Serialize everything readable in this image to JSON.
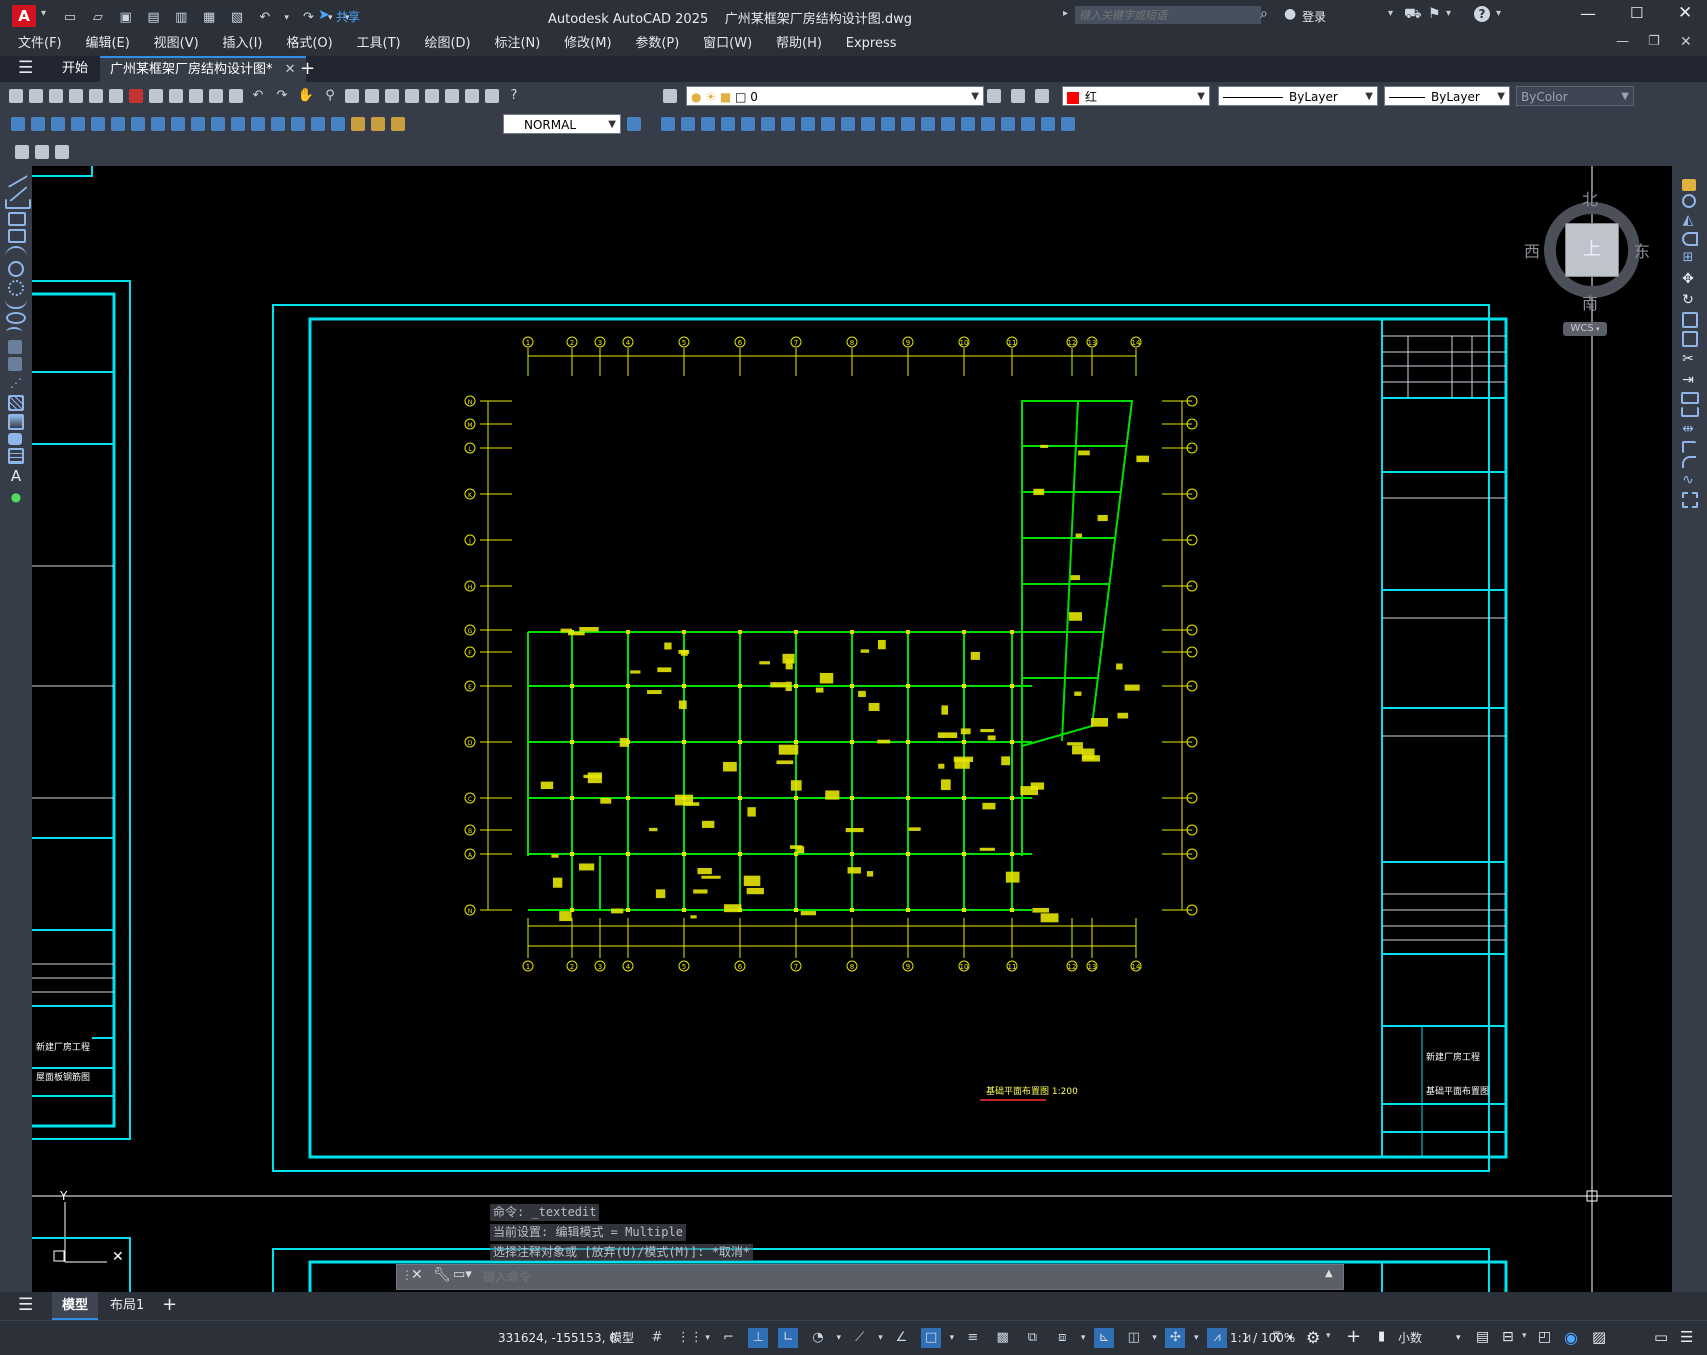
{
  "app": {
    "title": "Autodesk AutoCAD 2025    广州某框架厂房结构设计图.dwg",
    "logo_letter": "A",
    "share_label": "共享",
    "search_placeholder": "键入关键字或短语",
    "login_label": "登录"
  },
  "menu": [
    "文件(F)",
    "编辑(E)",
    "视图(V)",
    "插入(I)",
    "格式(O)",
    "工具(T)",
    "绘图(D)",
    "标注(N)",
    "修改(M)",
    "参数(P)",
    "窗口(W)",
    "帮助(H)",
    "Express"
  ],
  "tabs": {
    "start": "开始",
    "document": "广州某框架厂房结构设计图*",
    "add": "+"
  },
  "properties": {
    "layer": "0",
    "color": "红",
    "color_hex": "#ff0000",
    "linetype": "ByLayer",
    "lineweight": "ByLayer",
    "plotstyle": "ByColor",
    "dimstyle": "NORMAL"
  },
  "viewcube": {
    "north": "北",
    "south": "南",
    "east": "东",
    "west": "西",
    "top": "上",
    "wcs": "WCS"
  },
  "drawing": {
    "plan_caption": "基础平面布置图 1:200",
    "title_block_project": "新建厂房工程",
    "title_block_drawing": "基础平面布置图",
    "left_block_project": "新建厂房工程",
    "left_block_drawing": "屋面板钢筋图",
    "axis_x_top": [
      "1",
      "2",
      "3",
      "4",
      "5",
      "6",
      "7",
      "8",
      "9",
      "10",
      "11",
      "12",
      "13",
      "14"
    ],
    "axis_y_left": [
      "N",
      "M",
      "L",
      "K",
      "J",
      "H",
      "G",
      "F",
      "E",
      "D",
      "C",
      "B",
      "A"
    ]
  },
  "command": {
    "history": [
      "命令: _textedit",
      "当前设置: 编辑模式 = Multiple",
      "选择注释对象或 [放弃(U)/模式(M)]: *取消*"
    ],
    "placeholder": "键入命令"
  },
  "layouts": [
    "模型",
    "布局1"
  ],
  "status": {
    "coordinates": "331624, -155153, 0",
    "model_label": "模型",
    "scale": "1:1 / 100%",
    "units": "小数"
  },
  "colors": {
    "accent": "#00e5ff",
    "frame_cyan": "#00e0ee",
    "beam_green": "#00e000",
    "dim_yellow": "#e6e600",
    "brand_red": "#d4121f"
  }
}
